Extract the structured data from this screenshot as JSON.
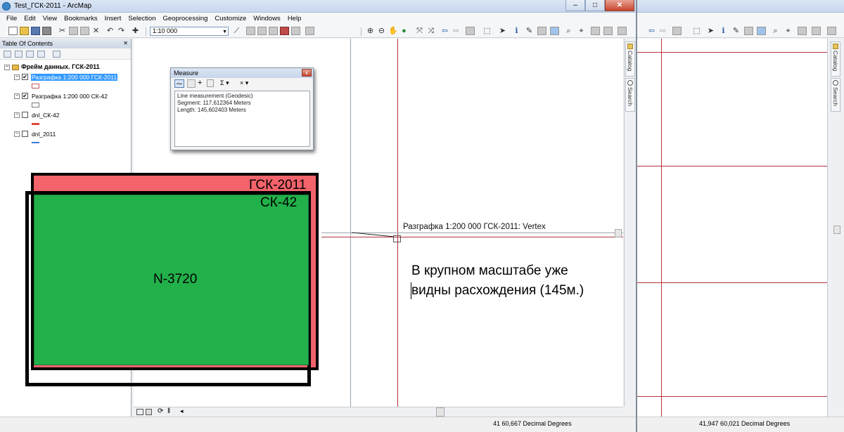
{
  "window": {
    "title": "Test_ГСК-2011 - ArcMap",
    "controls": [
      "–",
      "□",
      "✕"
    ]
  },
  "menu": [
    "File",
    "Edit",
    "View",
    "Bookmarks",
    "Insert",
    "Selection",
    "Geoprocessing",
    "Customize",
    "Windows",
    "Help"
  ],
  "toolbar": {
    "scale": "1:10 000"
  },
  "toc": {
    "title": "Table Of Contents",
    "close": "✕",
    "frame": "Фрейм данных. ГСК-2011",
    "layers": [
      {
        "label": "Разграфка 1:200 000 ГСК-2011",
        "checked": true,
        "selected": true,
        "symbol_color": "#c9555c"
      },
      {
        "label": "Разграфка 1:200 000 СК-42",
        "checked": true,
        "selected": false,
        "symbol_color": "#7a7a7a"
      },
      {
        "label": "dnl_СК-42",
        "checked": false,
        "selected": false,
        "symbol_color": "#e04a3c"
      },
      {
        "label": "dnl_2011",
        "checked": false,
        "selected": false,
        "symbol_color": "#3a7bd5"
      }
    ]
  },
  "measure": {
    "title": "Measure",
    "close": "x",
    "tools": [
      "Σ ▾",
      "× ▾"
    ],
    "lines": [
      "Line measurement (Geodesic)",
      "Segment: 117,612364 Meters",
      "Length: 145,602403 Meters"
    ]
  },
  "map": {
    "vertex_label": "Разграфка 1:200 000 ГСК-2011: Vertex"
  },
  "overlay": {
    "gsk_label": "ГСК-2011",
    "sk_label": "СК-42",
    "sheet_label": "N-3720",
    "note_line1": "В крупном масштабе уже",
    "note_line2": "видны расхождения (145м.)",
    "colors": {
      "gsk": "#f2636b",
      "sheet": "#22b04a",
      "boundary_line": "#b5353d"
    }
  },
  "side_tabs": [
    "Catalog",
    "Search"
  ],
  "status": {
    "left": "41  60,667 Decimal Degrees"
  },
  "window2": {
    "side_tabs": [
      "Catalog",
      "Search"
    ],
    "status": "41,947  60,021 Decimal Degrees"
  }
}
